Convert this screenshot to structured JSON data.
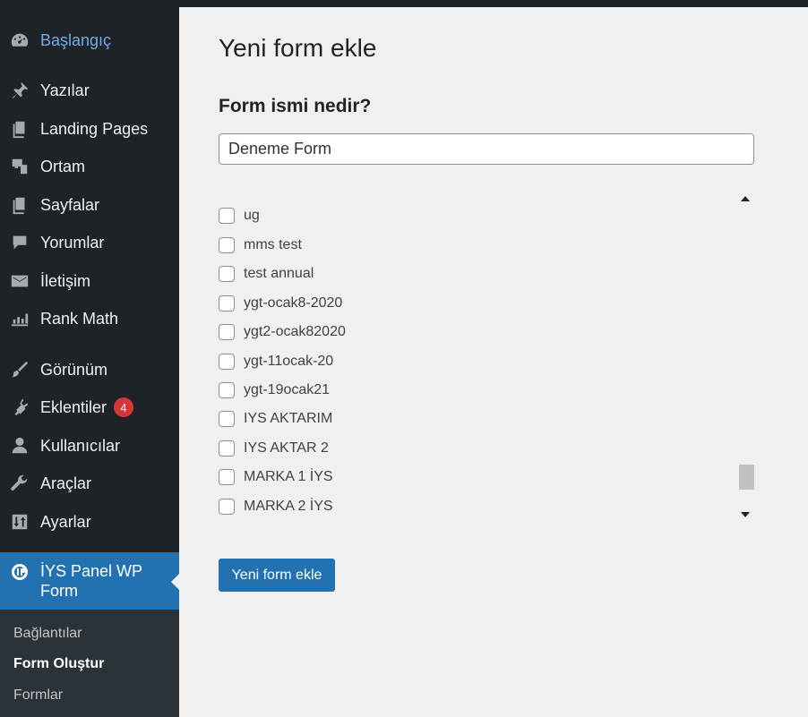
{
  "sidebar": {
    "items": [
      {
        "label": "Başlangıç",
        "icon": "dashboard-icon"
      },
      {
        "label": "Yazılar",
        "icon": "pin-icon"
      },
      {
        "label": "Landing Pages",
        "icon": "pages-icon"
      },
      {
        "label": "Ortam",
        "icon": "media-icon"
      },
      {
        "label": "Sayfalar",
        "icon": "pages-icon"
      },
      {
        "label": "Yorumlar",
        "icon": "comment-icon"
      },
      {
        "label": "İletişim",
        "icon": "mail-icon"
      },
      {
        "label": "Rank Math",
        "icon": "chart-icon"
      },
      {
        "label": "Görünüm",
        "icon": "brush-icon"
      },
      {
        "label": "Eklentiler",
        "icon": "plugin-icon",
        "badge": "4"
      },
      {
        "label": "Kullanıcılar",
        "icon": "user-icon"
      },
      {
        "label": "Araçlar",
        "icon": "wrench-icon"
      },
      {
        "label": "Ayarlar",
        "icon": "settings-icon"
      }
    ],
    "active": {
      "label": "İYS Panel WP Form",
      "icon": "iys-logo-icon"
    },
    "submenu": [
      {
        "label": "Bağlantılar"
      },
      {
        "label": "Form Oluştur"
      },
      {
        "label": "Formlar"
      }
    ]
  },
  "main": {
    "title": "Yeni form ekle",
    "section_label": "Form ismi nedir?",
    "form_name_value": "Deneme Form",
    "list_items": [
      "ug",
      "mms test",
      "test annual",
      "ygt-ocak8-2020",
      "ygt2-ocak82020",
      "ygt-11ocak-20",
      "ygt-19ocak21",
      "IYS AKTARIM",
      "IYS AKTAR 2",
      "MARKA 1 İYS",
      "MARKA 2 İYS"
    ],
    "submit_label": "Yeni form ekle"
  },
  "colors": {
    "sidebar_bg": "#1d2327",
    "accent": "#2271b1",
    "badge": "#d63638",
    "current_link": "#72aee6"
  }
}
